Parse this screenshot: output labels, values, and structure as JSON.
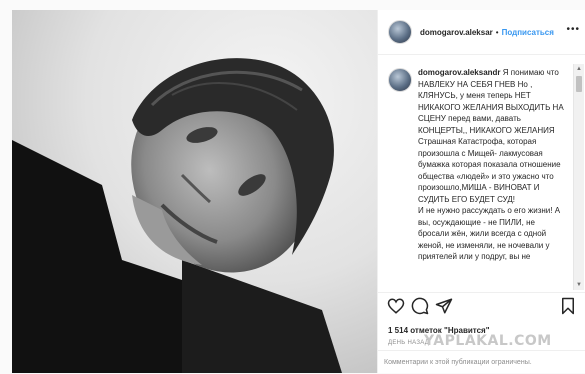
{
  "post": {
    "username": "domogarov.aleksandr",
    "username_header": "domogarov.aleksar",
    "follow_label": "Подписаться",
    "more_icon": "ellipsis-icon",
    "caption_text": "Я понимаю что НАВЛЕКУ НА СЕБЯ ГНЕВ Но , КЛЯНУСЬ, у меня теперь НЕТ НИКАКОГО ЖЕЛАНИЯ ВЫХОДИТЬ НА СЦЕНУ перед вами, давать КОНЦЕРТЫ,, НИКАКОГО ЖЕЛАНИЯ\nСтрашная Катастрофа, которая произошла с Мищей- лакмусовая бумажка которая показала отношение общества «людей» и это ужасно что произошло,МИША - ВИНОВАТ И СУДИТЬ ЕГО БУДЕТ СУД!\nИ не нужно рассуждать о его жизни! А вы, осуждающие - не ПИЛИ, не бросали жён, жили всегда с одной женой, не изменяли, не ночевали у приятелей или у подруг, вы не",
    "likes": "1 514 отметок \"Нравится\"",
    "time_ago": "ДЕНЬ НАЗАД",
    "comments_disabled": "Комментарии к этой публикации ограничены."
  },
  "watermark": "YAPLAKAL.COM",
  "icons": [
    "heart-icon",
    "comment-icon",
    "share-icon",
    "bookmark-icon"
  ]
}
